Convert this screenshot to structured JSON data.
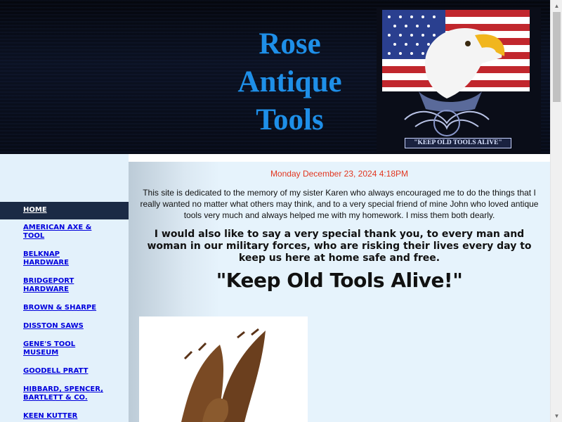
{
  "header": {
    "title_lines": [
      "Rose",
      "Antique",
      "Tools"
    ],
    "logo_caption": "\"KEEP OLD TOOLS ALIVE\""
  },
  "sidebar": {
    "items": [
      {
        "label": "HOME",
        "active": true
      },
      {
        "label": "AMERICAN AXE & TOOL"
      },
      {
        "label": "BELKNAP HARDWARE"
      },
      {
        "label": "BRIDGEPORT HARDWARE"
      },
      {
        "label": "BROWN & SHARPE"
      },
      {
        "label": "DISSTON SAWS"
      },
      {
        "label": "GENE'S TOOL MUSEUM"
      },
      {
        "label": "GOODELL PRATT"
      },
      {
        "label": "HIBBARD, SPENCER, BARTLETT & CO."
      },
      {
        "label": "KEEN KUTTER"
      }
    ]
  },
  "main": {
    "date": "Monday December 23, 2024 4:18PM",
    "dedication": "This site is dedicated to the memory of my sister Karen  who always encouraged me to do the things that  I really wanted no matter what others may think, and to a very special friend of mine John who loved antique tools very much and always helped me with my homework.  I miss them both dearly.",
    "thanks": "I would also like to say a very special thank you, to every man and woman in our military forces, who are risking their lives every day to keep us here at home safe and free.",
    "motto": "\"Keep Old Tools Alive!\""
  },
  "colors": {
    "title_blue": "#1e8fe8",
    "date_red": "#e2361f",
    "nav_link": "#0000dd",
    "nav_active_bg": "#1b2a45",
    "sidebar_bg": "#e3f1fb"
  }
}
